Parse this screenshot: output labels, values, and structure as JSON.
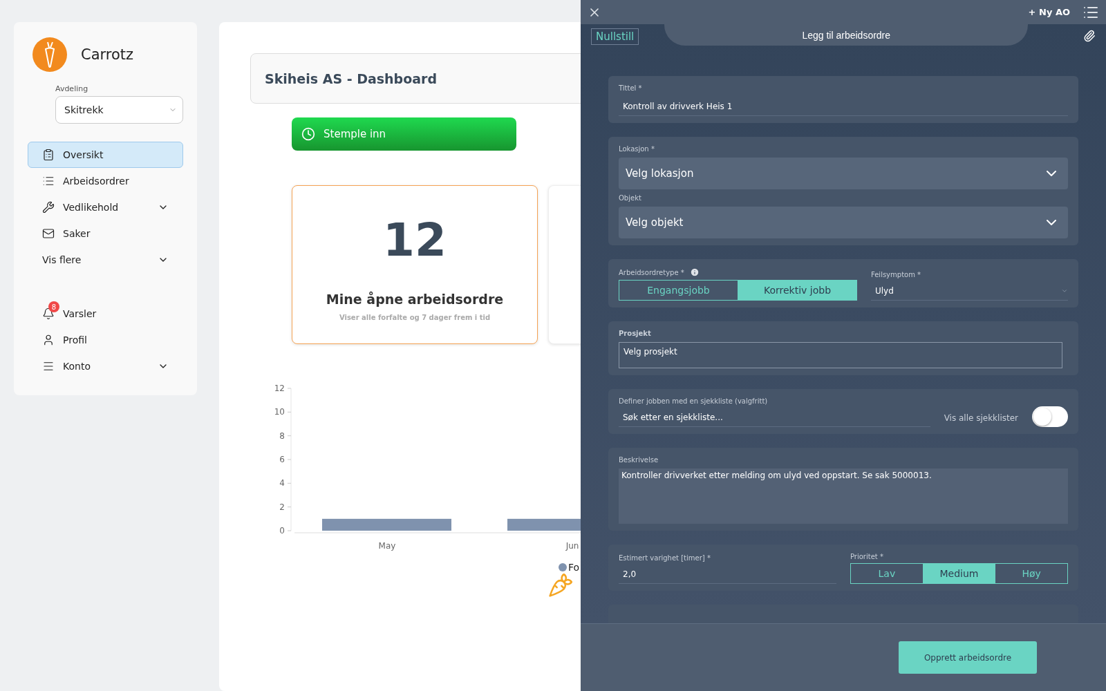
{
  "sidebar": {
    "brand": "Carrotz",
    "department": {
      "label": "Avdeling",
      "value": "Skitrekk"
    },
    "nav": [
      {
        "label": "Oversikt",
        "selected": true,
        "kind": "link"
      },
      {
        "label": "Arbeidsordrer",
        "selected": false,
        "kind": "link"
      },
      {
        "label": "Vedlikehold",
        "selected": false,
        "kind": "group"
      },
      {
        "label": "Saker",
        "selected": false,
        "kind": "link"
      },
      {
        "label": "Vis flere",
        "selected": false,
        "kind": "more"
      }
    ],
    "account": [
      {
        "label": "Varsler",
        "badge": "8",
        "kind": "link"
      },
      {
        "label": "Profil",
        "kind": "link"
      },
      {
        "label": "Konto",
        "kind": "group"
      }
    ]
  },
  "dashboard": {
    "title": "Skiheis AS - Dashboard",
    "clock_button": "Stemple inn",
    "cards": [
      {
        "value": "12",
        "title": "Mine åpne arbeidsordre",
        "subtitle": "Viser alle forfalte og 7 dager frem i tid",
        "highlighted": true
      },
      {
        "highlighted": false
      }
    ],
    "chart_data": {
      "type": "bar",
      "categories": [
        "May",
        "Jun"
      ],
      "series": [
        {
          "name": "Fo",
          "color": "#7f92ae",
          "values": [
            1,
            1
          ]
        }
      ],
      "ylim": [
        0,
        12
      ],
      "yticks": [
        0,
        2,
        4,
        6,
        8,
        10,
        12
      ]
    }
  },
  "panel": {
    "new_button": "+ Ny AO",
    "reset_button": "Nullstill",
    "title": "Legg til arbeidsordre",
    "title_field": {
      "label": "Tittel *",
      "value": "Kontroll av drivverk Heis 1"
    },
    "location": {
      "label": "Lokasjon *",
      "placeholder": "Velg lokasjon"
    },
    "object": {
      "label": "Objekt",
      "placeholder": "Velg objekt"
    },
    "order_type": {
      "label": "Arbeidsordretype *",
      "options": [
        {
          "label": "Engangsjobb",
          "selected": false
        },
        {
          "label": "Korrektiv jobb",
          "selected": true
        }
      ]
    },
    "symptom": {
      "label": "Feilsymptom *",
      "value": "Ulyd"
    },
    "project": {
      "label": "Prosjekt",
      "placeholder": "Velg prosjekt"
    },
    "checklist": {
      "label": "Definer jobben med en sjekkliste (valgfritt)",
      "placeholder": "Søk etter en sjekkliste...",
      "toggle_label": "Vis alle sjekklister",
      "on": false
    },
    "description": {
      "label": "Beskrivelse",
      "value": "Kontroller drivverket etter melding om ulyd ved oppstart. Se sak 5000013."
    },
    "duration": {
      "label": "Estimert varighet [timer] *",
      "value": "2,0"
    },
    "priority": {
      "label": "Prioritet *",
      "options": [
        {
          "label": "Lav",
          "selected": false
        },
        {
          "label": "Medium",
          "selected": true
        },
        {
          "label": "Høy",
          "selected": false
        }
      ]
    },
    "submit_button": "Opprett arbeidsordre"
  }
}
